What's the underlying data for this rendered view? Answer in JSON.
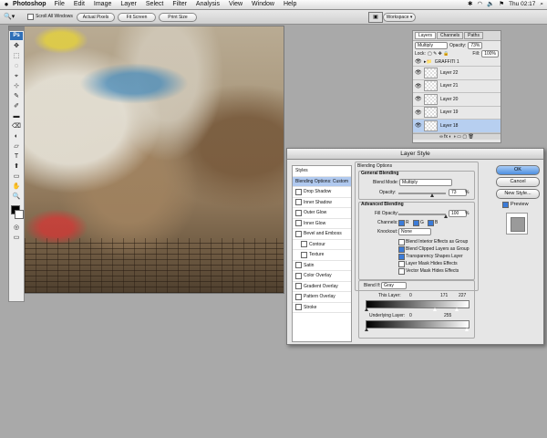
{
  "menubar": {
    "apple": "",
    "app": "Photoshop",
    "items": [
      "File",
      "Edit",
      "Image",
      "Layer",
      "Select",
      "Filter",
      "Analysis",
      "View",
      "Window",
      "Help"
    ],
    "clock": "Thu 02:17"
  },
  "options": {
    "scroll_all": "Scroll All Windows",
    "actual_pixels": "Actual Pixels",
    "fit_screen": "Fit Screen",
    "print_size": "Print Size",
    "workspace": "Workspace ▾"
  },
  "tools": {
    "logo": "Ps",
    "glyphs": [
      "✥",
      "⬚",
      "◌",
      "⌖",
      "⊹",
      "✎",
      "✐",
      "▬",
      "⌫",
      "◐",
      "▱",
      "T",
      "⬆",
      "▭",
      "✋",
      "🔍"
    ]
  },
  "layers_panel": {
    "tabs": [
      "Layers",
      "Channels",
      "Paths"
    ],
    "blend_mode": "Multiply",
    "opacity_label": "Opacity:",
    "opacity": "73%",
    "lock_label": "Lock:",
    "fill_label": "Fill:",
    "fill": "100%",
    "group": "GRAFFITI 1",
    "layers": [
      "Layer 22",
      "Layer 21",
      "Layer 20",
      "Layer 19",
      "Layer 18"
    ]
  },
  "dialog": {
    "title": "Layer Style",
    "styles": [
      "Styles",
      "Blending Options: Custom",
      "Drop Shadow",
      "Inner Shadow",
      "Outer Glow",
      "Inner Glow",
      "Bevel and Emboss",
      "Contour",
      "Texture",
      "Satin",
      "Color Overlay",
      "Gradient Overlay",
      "Pattern Overlay",
      "Stroke"
    ],
    "blending_options": "Blending Options",
    "general_blending": "General Blending",
    "blend_mode_label": "Blend Mode:",
    "blend_mode": "Multiply",
    "opacity_label": "Opacity:",
    "opacity": "73",
    "pct": "%",
    "advanced_blending": "Advanced Blending",
    "fill_opacity_label": "Fill Opacity:",
    "fill_opacity": "100",
    "channels_label": "Channels:",
    "ch_r": "R",
    "ch_g": "G",
    "ch_b": "B",
    "knockout_label": "Knockout:",
    "knockout": "None",
    "checks": [
      "Blend Interior Effects as Group",
      "Blend Clipped Layers as Group",
      "Transparency Shapes Layer",
      "Layer Mask Hides Effects",
      "Vector Mask Hides Effects"
    ],
    "checks_on": [
      false,
      true,
      true,
      false,
      false
    ],
    "blend_if_label": "Blend If:",
    "blend_if": "Gray",
    "this_layer_label": "This Layer:",
    "this_layer_min": "0",
    "this_layer_mid": "171",
    "this_layer_max": "227",
    "underlying_label": "Underlying Layer:",
    "underlying_min": "0",
    "underlying_max": "255",
    "ok": "OK",
    "cancel": "Cancel",
    "new_style": "New Style...",
    "preview": "Preview"
  }
}
